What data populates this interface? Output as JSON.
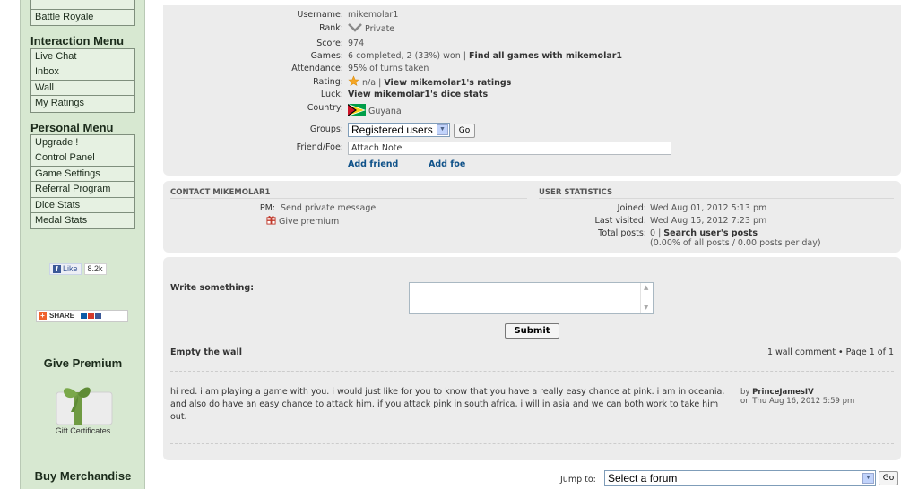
{
  "sidebar": {
    "top_items": [
      "Battle Royale"
    ],
    "interaction_menu": {
      "title": "Interaction Menu",
      "items": [
        "Live Chat",
        "Inbox",
        "Wall",
        "My Ratings"
      ]
    },
    "personal_menu": {
      "title": "Personal Menu",
      "items": [
        "Upgrade !",
        "Control Panel",
        "Game Settings",
        "Referral Program",
        "Dice Stats",
        "Medal Stats"
      ]
    },
    "facebook": {
      "like_label": "Like",
      "count": "8.2k"
    },
    "share_label": "SHARE",
    "give_premium": {
      "title": "Give Premium",
      "caption": "Gift Certificates"
    },
    "buy_merchandise": "Buy Merchandise"
  },
  "profile": {
    "username": {
      "label": "Username:",
      "value": "mikemolar1"
    },
    "rank": {
      "label": "Rank:",
      "value": "Private"
    },
    "score": {
      "label": "Score:",
      "value": "974"
    },
    "games": {
      "label": "Games:",
      "value": "6 completed, 2 (33%) won |",
      "link": "Find all games with mikemolar1"
    },
    "attendance": {
      "label": "Attendance:",
      "value": "95% of turns taken"
    },
    "rating": {
      "label": "Rating:",
      "value": "n/a |",
      "link": "View mikemolar1's ratings"
    },
    "luck": {
      "label": "Luck:",
      "link": "View mikemolar1's dice stats"
    },
    "country": {
      "label": "Country:",
      "value": "Guyana"
    },
    "groups": {
      "label": "Groups:",
      "selected": "Registered users",
      "go": "Go"
    },
    "friend_foe": {
      "label": "Friend/Foe:",
      "placeholder": "Attach Note",
      "add_friend": "Add friend",
      "add_foe": "Add foe"
    }
  },
  "contact": {
    "title": "CONTACT MIKEMOLAR1",
    "pm_label": "PM:",
    "pm_link": "Send private message",
    "give_premium": "Give premium"
  },
  "user_stats": {
    "title": "USER STATISTICS",
    "joined": {
      "label": "Joined:",
      "value": "Wed Aug 01, 2012 5:13 pm"
    },
    "last_visited": {
      "label": "Last visited:",
      "value": "Wed Aug 15, 2012 7:23 pm"
    },
    "total_posts": {
      "label": "Total posts:",
      "value": "0 |",
      "link": "Search user's posts",
      "detail": "(0.00% of all posts / 0.00 posts per day)"
    }
  },
  "wall": {
    "write_label": "Write something:",
    "submit": "Submit",
    "empty": "Empty the wall",
    "pagination": "1 wall comment • Page 1 of 1",
    "comment": {
      "text": "hi red. i am playing a game with you. i would just like for you to know that you have a really easy chance at pink. i am in oceania, and also do have an easy chance to attack him. if you attack pink in south africa, i will in asia and we can both work to take him out.",
      "by": "by",
      "author": "PrinceJamesIV",
      "date": "on Thu Aug 16, 2012 5:59 pm"
    }
  },
  "jump": {
    "label": "Jump to:",
    "selected": "Select a forum",
    "go": "Go"
  },
  "colors": {
    "sidebar_bg": "#d7e8d1",
    "panel_bg": "#ececec",
    "link": "#105289"
  }
}
